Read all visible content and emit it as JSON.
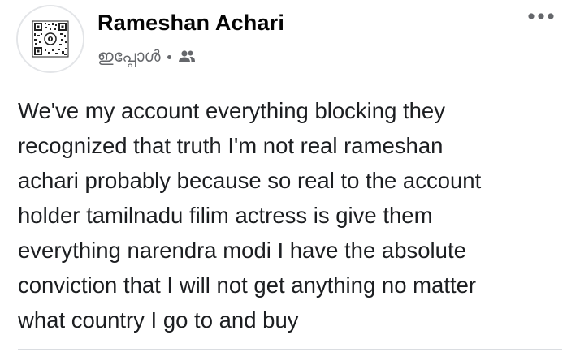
{
  "post": {
    "author_name": "Rameshan Achari",
    "timestamp": "ഇപ്പോൾ",
    "audience_icon": "friends-icon",
    "more_icon": "more-options-icon",
    "text_lines": [
      "We've my account everything blocking they",
      "recognized that truth I'm not real rameshan",
      "achari probably because so real to the account",
      "holder tamilnadu filim actress is give them",
      "everything narendra modi I have the absolute",
      "conviction that I will not get anything no matter",
      "what country I go to and buy"
    ]
  },
  "colors": {
    "name": "#050505",
    "meta": "#65676b",
    "body": "#1c1e21",
    "divider": "#dadde1"
  }
}
